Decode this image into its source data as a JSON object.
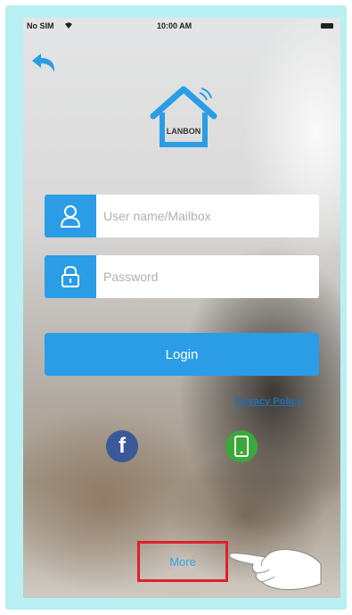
{
  "status_bar": {
    "carrier": "No SIM",
    "time": "10:00 AM"
  },
  "logo": {
    "text": "LANBON"
  },
  "form": {
    "username_placeholder": "User name/Mailbox",
    "password_placeholder": "Password",
    "login_label": "Login"
  },
  "privacy_label": "Privacy Policy",
  "more_label": "More",
  "colors": {
    "accent": "#2a9de6",
    "facebook": "#3b5998",
    "phone": "#3aa83a",
    "highlight_box": "#e0202a",
    "frame": "#b9f0f3"
  },
  "icons": {
    "back": "back-arrow-icon",
    "user": "user-icon",
    "lock": "lock-icon",
    "facebook": "facebook-icon",
    "phone": "phone-icon",
    "wifi": "wifi-icon",
    "battery": "battery-icon"
  }
}
